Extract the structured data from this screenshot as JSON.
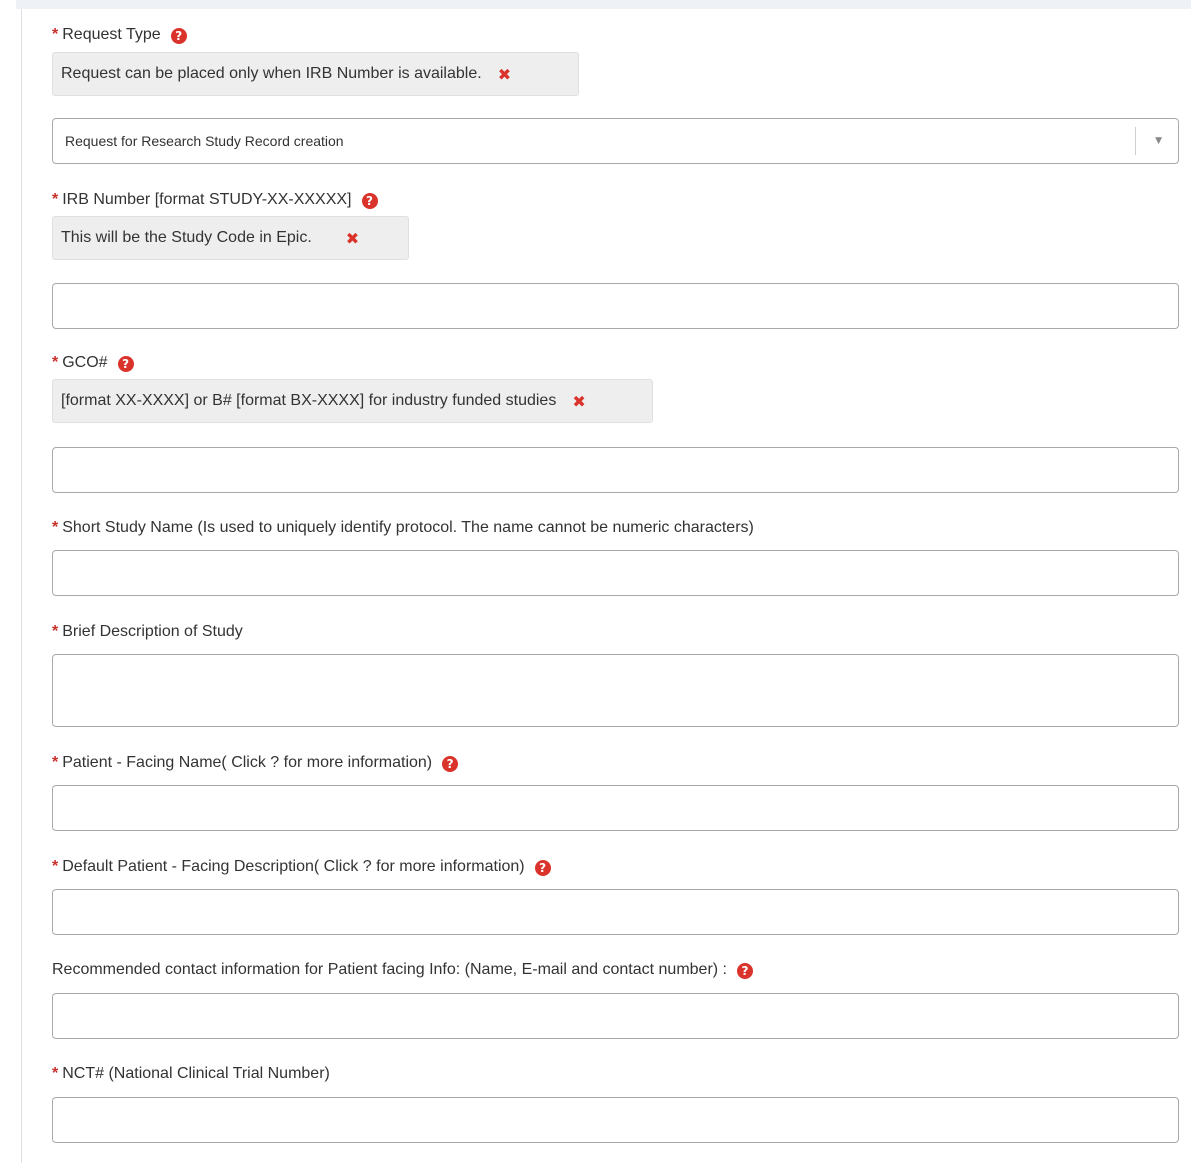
{
  "required_mark": "*",
  "help_icon": "question-circle-icon",
  "close_icon": "times-icon",
  "colors": {
    "accent_red": "#d9332b",
    "border": "#a9a9a9",
    "help_bg": "#eeeeee"
  },
  "request_type": {
    "label": "Request Type",
    "help": "Request can be placed only when IRB Number is available.",
    "selected": "Request for Research Study Record creation",
    "dropdown_icon": "▼"
  },
  "irb": {
    "label": "IRB Number [format STUDY-XX-XXXXX]",
    "help": "This will be the Study Code in Epic.",
    "value": ""
  },
  "gco": {
    "label": "GCO#",
    "help": "[format XX-XXXX] or B# [format BX-XXXX] for industry funded studies",
    "value": ""
  },
  "short_name": {
    "label": "Short Study Name (Is used to uniquely identify protocol. The name cannot be numeric characters)",
    "value": ""
  },
  "brief_desc": {
    "label": "Brief Description of Study",
    "value": ""
  },
  "patient_name": {
    "label": "Patient - Facing Name( Click ? for more information)",
    "value": ""
  },
  "patient_desc": {
    "label": "Default Patient - Facing Description( Click ? for more information)",
    "value": ""
  },
  "contact": {
    "label": "Recommended contact information for Patient facing Info: (Name, E-mail and contact number) :",
    "value": ""
  },
  "nct": {
    "label": "NCT# (National Clinical Trial Number)",
    "value": ""
  }
}
